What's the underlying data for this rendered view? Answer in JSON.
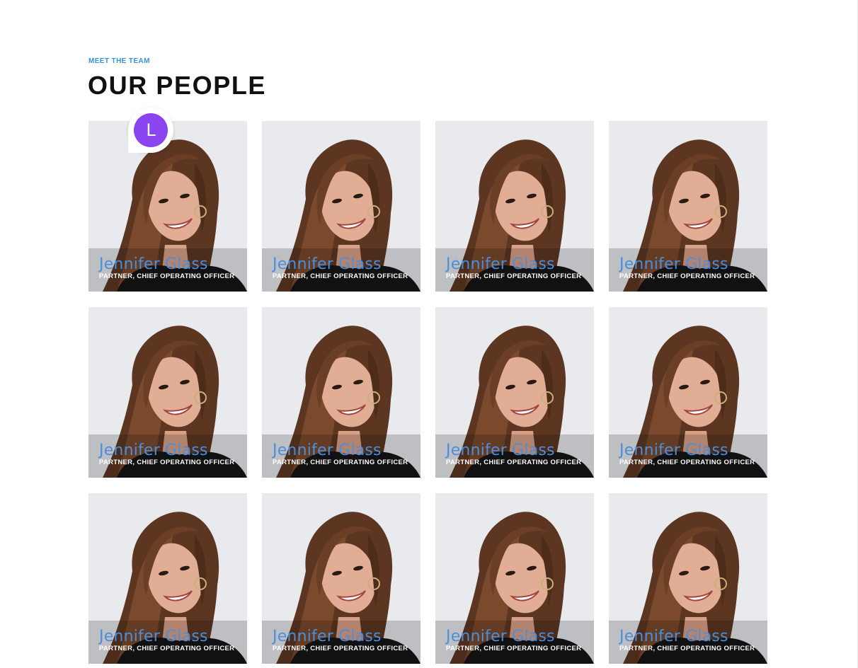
{
  "section": {
    "eyebrow": "MEET THE TEAM",
    "title": "OUR PEOPLE"
  },
  "avatar": {
    "initial": "L",
    "color": "#8a44f0"
  },
  "colors": {
    "accent": "#3a92d8",
    "name": "#4a8fdd"
  },
  "team": [
    {
      "name": "Jennifer Glass",
      "role": "PARTNER, CHIEF OPERATING OFFICER"
    },
    {
      "name": "Jennifer Glass",
      "role": "PARTNER, CHIEF OPERATING OFFICER"
    },
    {
      "name": "Jennifer Glass",
      "role": "PARTNER, CHIEF OPERATING OFFICER"
    },
    {
      "name": "Jennifer Glass",
      "role": "PARTNER, CHIEF OPERATING OFFICER"
    },
    {
      "name": "Jennifer Glass",
      "role": "PARTNER, CHIEF OPERATING OFFICER"
    },
    {
      "name": "Jennifer Glass",
      "role": "PARTNER, CHIEF OPERATING OFFICER"
    },
    {
      "name": "Jennifer Glass",
      "role": "PARTNER, CHIEF OPERATING OFFICER"
    },
    {
      "name": "Jennifer Glass",
      "role": "PARTNER, CHIEF OPERATING OFFICER"
    },
    {
      "name": "Jennifer Glass",
      "role": "PARTNER, CHIEF OPERATING OFFICER"
    },
    {
      "name": "Jennifer Glass",
      "role": "PARTNER, CHIEF OPERATING OFFICER"
    },
    {
      "name": "Jennifer Glass",
      "role": "PARTNER, CHIEF OPERATING OFFICER"
    },
    {
      "name": "Jennifer Glass",
      "role": "PARTNER, CHIEF OPERATING OFFICER"
    }
  ]
}
